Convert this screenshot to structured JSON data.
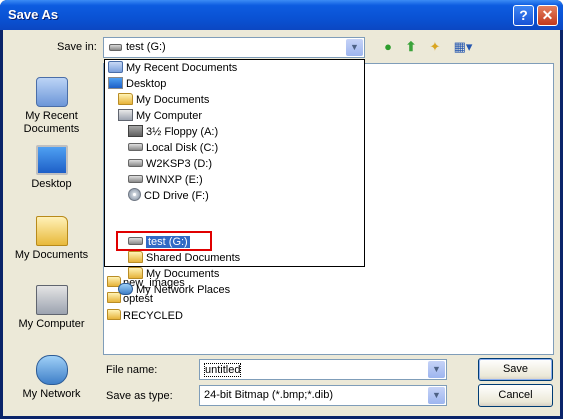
{
  "window": {
    "title": "Save As",
    "help_label": "?",
    "close_label": "✕"
  },
  "save_in": {
    "label": "Save in:",
    "value": "test (G:)",
    "dropdown_arrow": "▼"
  },
  "toolbar": {
    "back_icon": "back-arrow-icon",
    "up_icon": "up-folder-icon",
    "new_folder_icon": "new-folder-icon",
    "views_icon": "views-menu-icon"
  },
  "places": [
    {
      "label": "My Recent Documents",
      "icon": "recent-documents-icon"
    },
    {
      "label": "Desktop",
      "icon": "desktop-icon"
    },
    {
      "label": "My Documents",
      "icon": "my-documents-icon"
    },
    {
      "label": "My Computer",
      "icon": "my-computer-icon"
    },
    {
      "label": "My Network",
      "icon": "network-icon"
    }
  ],
  "dropdown_items": [
    {
      "label": "My Recent Documents",
      "icon": "recent"
    },
    {
      "label": "Desktop",
      "icon": "desktop"
    },
    {
      "label": "My Documents",
      "icon": "folder"
    },
    {
      "label": "My Computer",
      "icon": "computer"
    },
    {
      "label": "3½ Floppy (A:)",
      "icon": "floppy"
    },
    {
      "label": "Local Disk (C:)",
      "icon": "disk"
    },
    {
      "label": "W2KSP3 (D:)",
      "icon": "disk"
    },
    {
      "label": "WINXP (E:)",
      "icon": "disk"
    },
    {
      "label": "CD Drive (F:)",
      "icon": "cd"
    },
    {
      "label": "test (G:)",
      "icon": "disk",
      "selected": true
    },
    {
      "label": "Shared Documents",
      "icon": "folder"
    },
    {
      "label": "My Documents",
      "icon": "folder"
    },
    {
      "label": "My Network Places",
      "icon": "network"
    }
  ],
  "files": [
    {
      "name": "new_images",
      "icon": "folder"
    },
    {
      "name": "optest",
      "icon": "folder"
    },
    {
      "name": "RECYCLED",
      "icon": "folder"
    }
  ],
  "file_name": {
    "label": "File name:",
    "value": "untitled"
  },
  "save_as_type": {
    "label": "Save as type:",
    "value": "24-bit Bitmap (*.bmp;*.dib)"
  },
  "buttons": {
    "save": "Save",
    "cancel": "Cancel"
  }
}
